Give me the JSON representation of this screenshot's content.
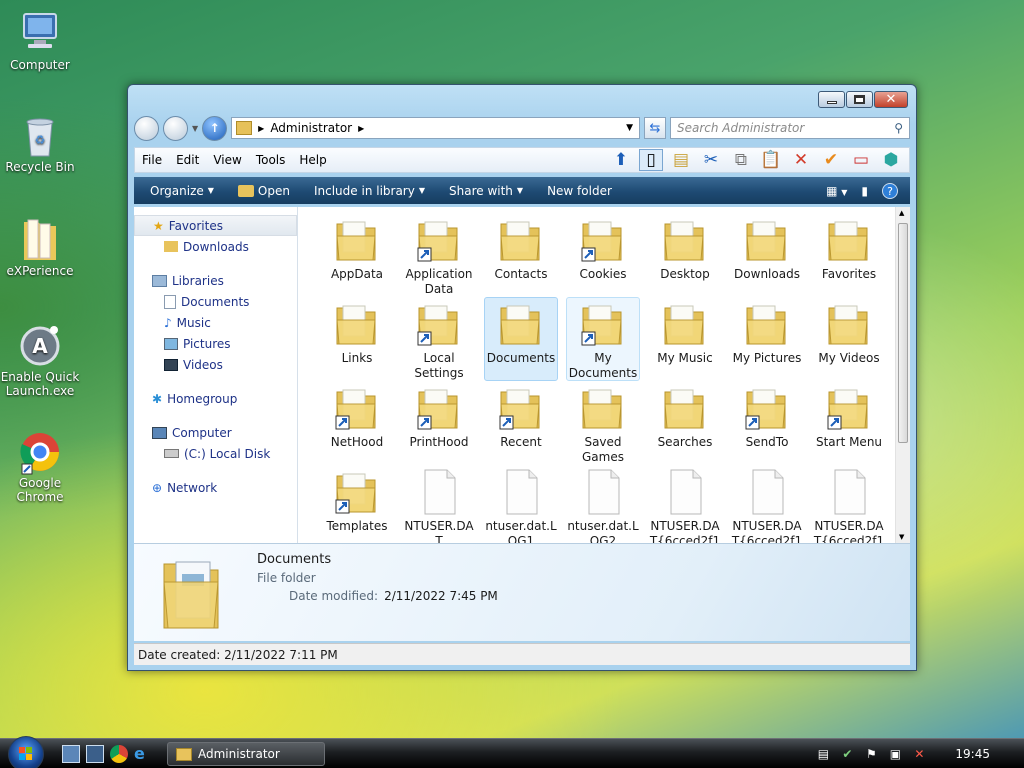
{
  "desktop": {
    "icons": [
      {
        "label": "Computer"
      },
      {
        "label": "Recycle Bin"
      },
      {
        "label": "eXPerience"
      },
      {
        "label": "Enable Quick Launch.exe"
      },
      {
        "label": "Google Chrome"
      }
    ]
  },
  "window": {
    "address": {
      "path": "Administrator"
    },
    "search": {
      "placeholder": "Search Administrator"
    },
    "menu": [
      "File",
      "Edit",
      "View",
      "Tools",
      "Help"
    ],
    "commands": {
      "organize": "Organize",
      "open": "Open",
      "include": "Include in library",
      "share": "Share with",
      "new_folder": "New folder"
    },
    "nav": {
      "favorites": "Favorites",
      "downloads": "Downloads",
      "libraries": "Libraries",
      "documents": "Documents",
      "music": "Music",
      "pictures": "Pictures",
      "videos": "Videos",
      "homegroup": "Homegroup",
      "computer": "Computer",
      "local_disk": "(C:) Local Disk",
      "network": "Network"
    },
    "files": [
      {
        "name": "AppData",
        "kind": "folder"
      },
      {
        "name": "Application Data",
        "kind": "shortcut"
      },
      {
        "name": "Contacts",
        "kind": "folder"
      },
      {
        "name": "Cookies",
        "kind": "shortcut"
      },
      {
        "name": "Desktop",
        "kind": "folder"
      },
      {
        "name": "Downloads",
        "kind": "folder"
      },
      {
        "name": "Favorites",
        "kind": "folder"
      },
      {
        "name": "Links",
        "kind": "folder"
      },
      {
        "name": "Local Settings",
        "kind": "shortcut"
      },
      {
        "name": "Documents",
        "kind": "folder"
      },
      {
        "name": "My Documents",
        "kind": "shortcut"
      },
      {
        "name": "My Music",
        "kind": "folder"
      },
      {
        "name": "My Pictures",
        "kind": "folder"
      },
      {
        "name": "My Videos",
        "kind": "folder"
      },
      {
        "name": "NetHood",
        "kind": "shortcut"
      },
      {
        "name": "PrintHood",
        "kind": "shortcut"
      },
      {
        "name": "Recent",
        "kind": "shortcut"
      },
      {
        "name": "Saved Games",
        "kind": "folder"
      },
      {
        "name": "Searches",
        "kind": "folder"
      },
      {
        "name": "SendTo",
        "kind": "shortcut"
      },
      {
        "name": "Start Menu",
        "kind": "shortcut"
      },
      {
        "name": "Templates",
        "kind": "shortcut"
      },
      {
        "name": "NTUSER.DAT",
        "kind": "file"
      },
      {
        "name": "ntuser.dat.LOG1",
        "kind": "file"
      },
      {
        "name": "ntuser.dat.LOG2",
        "kind": "file"
      },
      {
        "name": "NTUSER.DAT{6cced2f1",
        "kind": "file"
      },
      {
        "name": "NTUSER.DAT{6cced2f1",
        "kind": "file"
      },
      {
        "name": "NTUSER.DAT{6cced2f1",
        "kind": "file"
      }
    ],
    "details": {
      "name": "Documents",
      "type": "File folder",
      "modified_label": "Date modified:",
      "modified_value": "2/11/2022 7:45 PM"
    },
    "status": "Date created: 2/11/2022 7:11 PM"
  },
  "taskbar": {
    "task_label": "Administrator",
    "clock": "19:45"
  }
}
